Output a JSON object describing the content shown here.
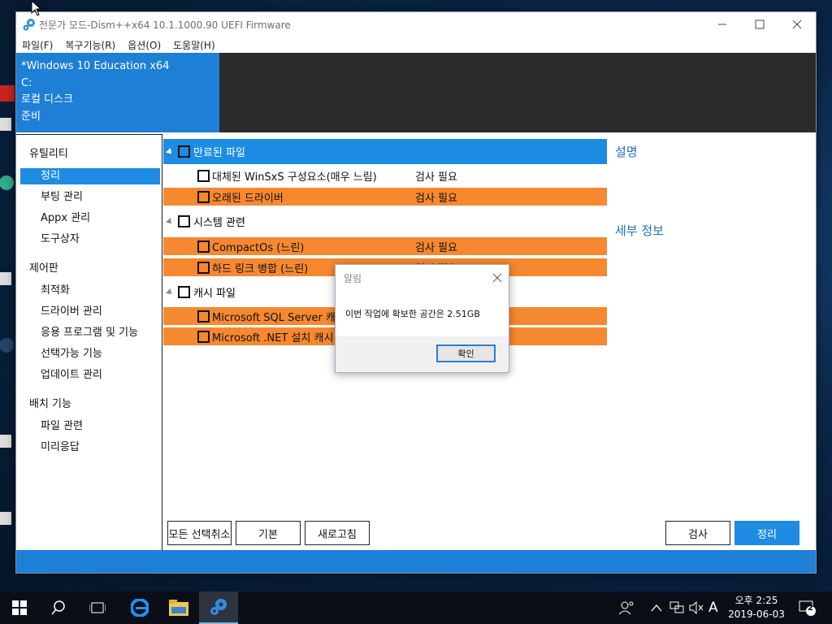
{
  "window": {
    "title": "전문가 모드-Dism++x64 10.1.1000.90 UEFI Firmware",
    "menu": [
      "파일(F)",
      "복구기능(R)",
      "옵션(O)",
      "도움말(H)"
    ]
  },
  "info_panel": {
    "os": "*Windows 10 Education x64",
    "drive": "C:",
    "disk": "로컬 디스크",
    "status": "준비"
  },
  "nav": {
    "section1": "유틸리티",
    "utilities": [
      "정리",
      "부팅 관리",
      "Appx 관리",
      "도구상자"
    ],
    "section2": "제어판",
    "control": [
      "최적화",
      "드라이버 관리",
      "응용 프로그램 및 기능",
      "선택가능 기능",
      "업데이트 관리"
    ],
    "section3": "배치 기능",
    "deploy": [
      "파일 관련",
      "미리응답"
    ]
  },
  "content": {
    "groups": [
      {
        "label": "만료된 파일"
      },
      {
        "label": "시스템 관련"
      },
      {
        "label": "캐시 파일"
      }
    ],
    "rows": [
      {
        "label": "대체된 WinSxS 구성요소(매우 느림)",
        "status": "검사 필요"
      },
      {
        "label": "오래된 드라이버",
        "status": "검사 필요"
      },
      {
        "label": "CompactOs (느린)",
        "status": "검사 필요"
      },
      {
        "label": "하드 링크 병합 (느린)",
        "status": "검사 필요"
      },
      {
        "label": "Microsoft SQL Server 캐시",
        "status": ""
      },
      {
        "label": "Microsoft .NET 설치 캐시",
        "status": ""
      }
    ]
  },
  "right_panel": {
    "description_title": "설명",
    "details_title": "세부 정보"
  },
  "buttons": {
    "deselect_all": "모든 선택취소",
    "default": "기본",
    "refresh": "새로고침",
    "scan": "검사",
    "clean": "정리"
  },
  "dialog": {
    "title": "알림",
    "message": "이번 작업에 확보한 공간은 2.51GB",
    "ok": "확인"
  },
  "taskbar": {
    "clock_time": "오후 2:25",
    "clock_date": "2019-06-03",
    "ime": "A",
    "notification_count": "2"
  },
  "colors": {
    "accent_blue": "#1e8ce3",
    "orange": "#f6882f"
  }
}
